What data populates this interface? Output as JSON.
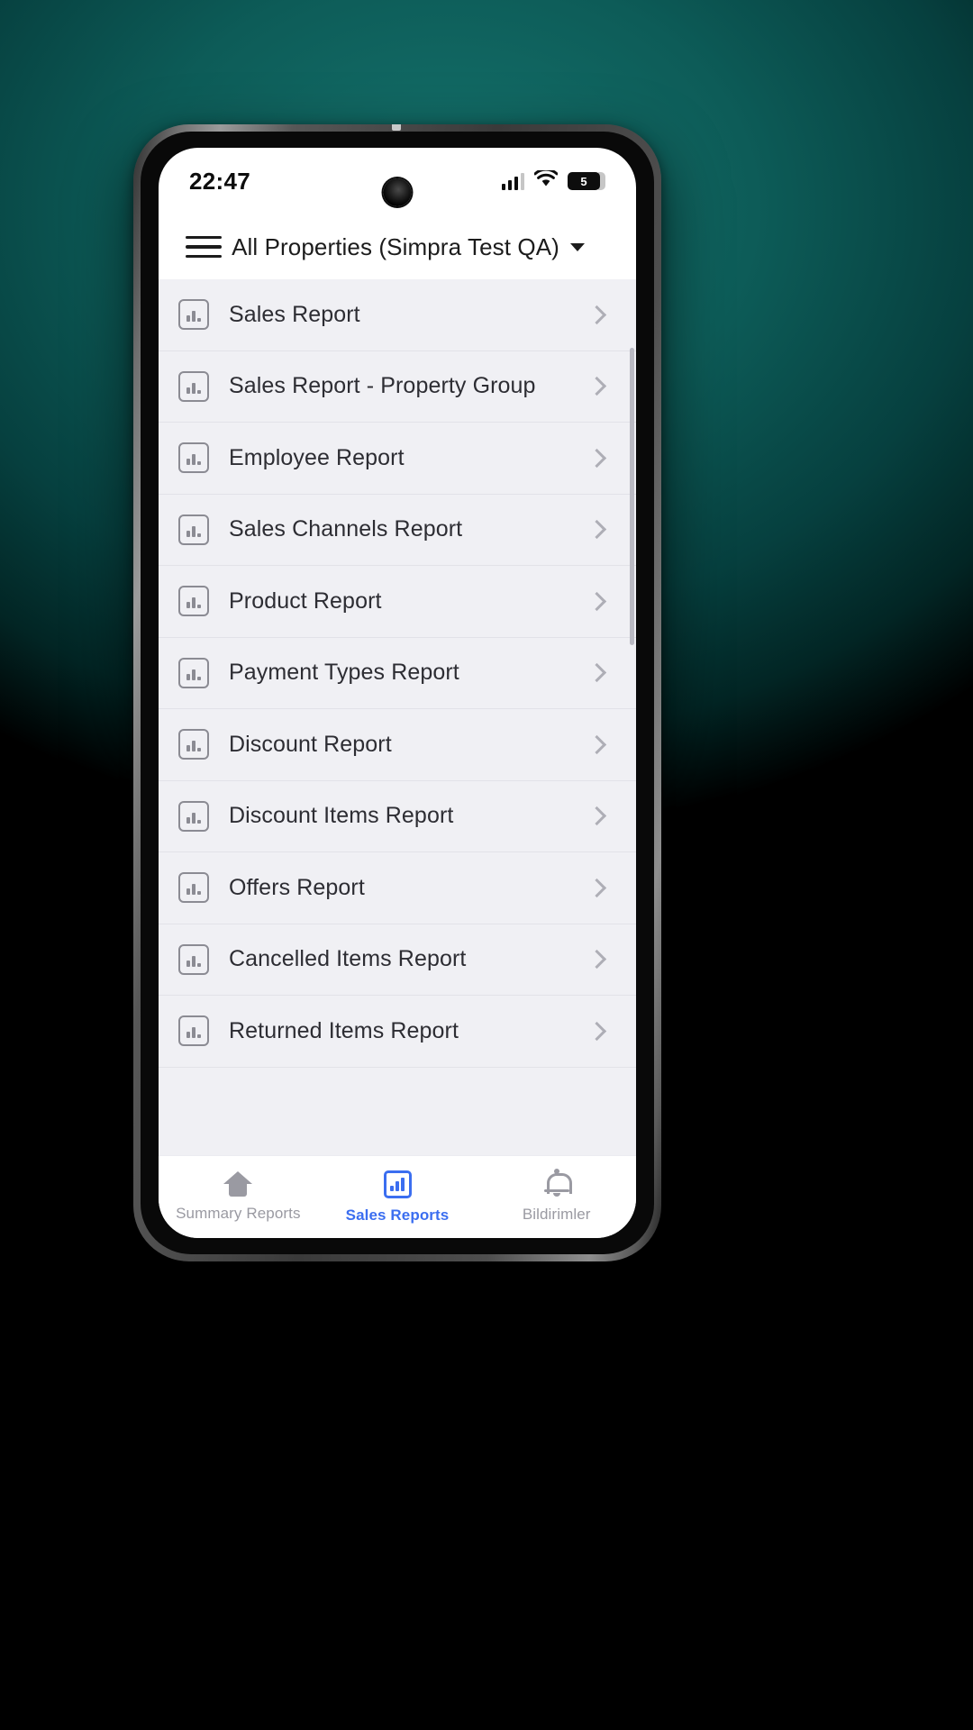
{
  "status_bar": {
    "time": "22:47",
    "signal_icon": "signal-bars-icon",
    "wifi_icon": "wifi-icon",
    "battery_level": "5",
    "battery_icon": "battery-icon"
  },
  "app_bar": {
    "menu_icon": "hamburger-menu-icon",
    "title": "All Properties (Simpra Test QA)",
    "caret_icon": "chevron-down-icon"
  },
  "report_list": {
    "items": [
      {
        "label": "Sales Report"
      },
      {
        "label": "Sales Report - Property Group"
      },
      {
        "label": "Employee Report"
      },
      {
        "label": "Sales Channels Report"
      },
      {
        "label": "Product Report"
      },
      {
        "label": "Payment Types Report"
      },
      {
        "label": "Discount Report"
      },
      {
        "label": "Discount Items Report"
      },
      {
        "label": "Offers Report"
      },
      {
        "label": "Cancelled Items Report"
      },
      {
        "label": "Returned Items Report"
      }
    ],
    "item_icon": "bar-chart-icon",
    "chevron_icon": "chevron-right-icon"
  },
  "bottom_nav": {
    "active_color": "#3b6ef0",
    "inactive_color": "#9a9aa2",
    "tabs": [
      {
        "label": "Summary Reports",
        "icon": "home-icon",
        "active": false
      },
      {
        "label": "Sales Reports",
        "icon": "bar-chart-icon",
        "active": true
      },
      {
        "label": "Bildirimler",
        "icon": "bell-icon",
        "active": false
      }
    ]
  }
}
